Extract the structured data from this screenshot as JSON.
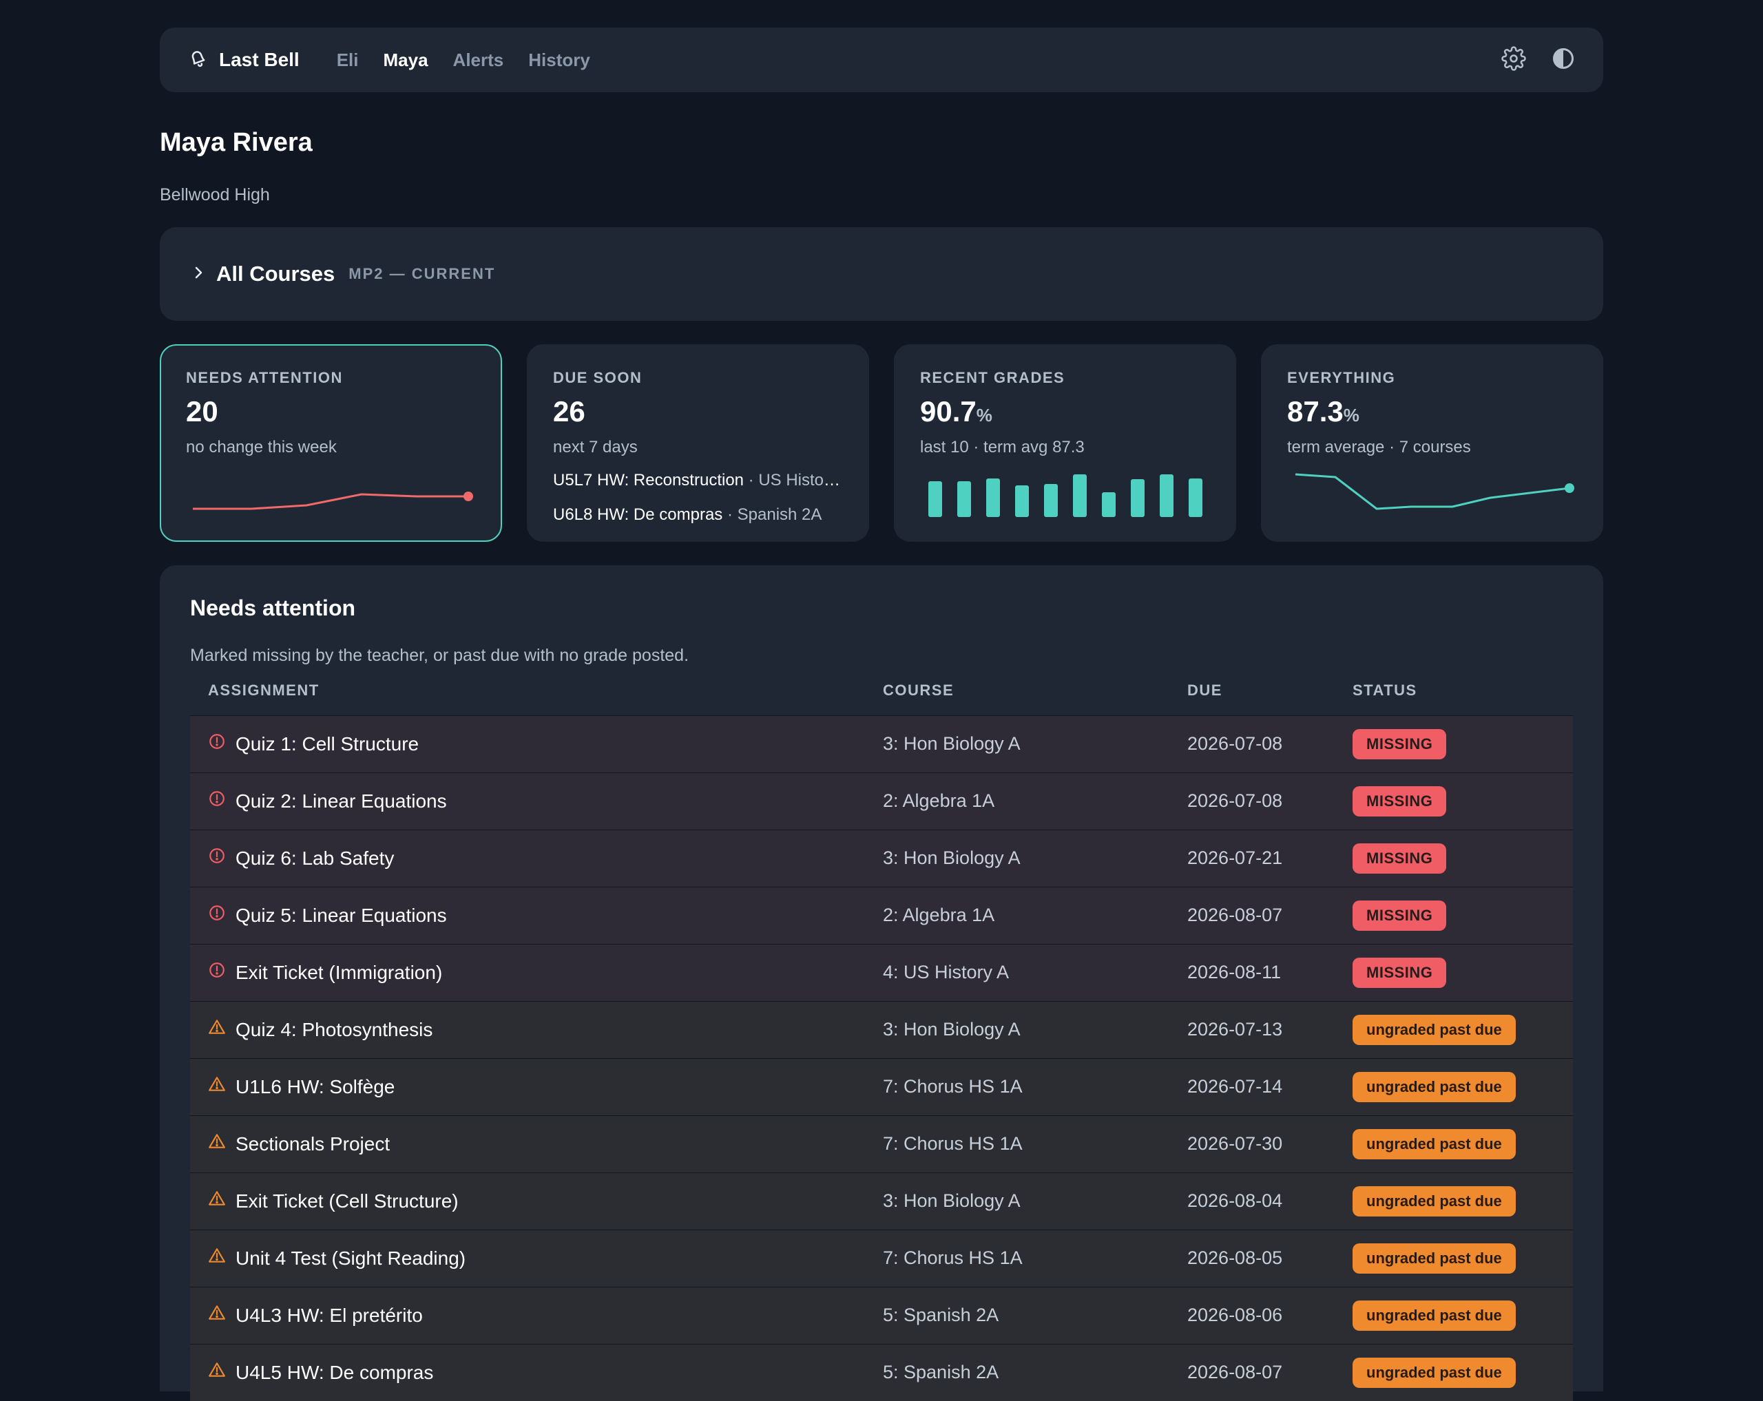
{
  "nav": {
    "brand": "Last Bell",
    "links": [
      {
        "label": "Eli",
        "active": false
      },
      {
        "label": "Maya",
        "active": true
      },
      {
        "label": "Alerts",
        "active": false
      },
      {
        "label": "History",
        "active": false
      }
    ],
    "icons": [
      "bell-icon",
      "gear-icon",
      "contrast-icon"
    ]
  },
  "student": {
    "name": "Maya Rivera",
    "school": "Bellwood High"
  },
  "courses": {
    "title": "All Courses",
    "period": "MP2 — CURRENT"
  },
  "cards": {
    "needs_attention": {
      "label": "NEEDS ATTENTION",
      "value": "20",
      "sub": "no change this week"
    },
    "due_soon": {
      "label": "DUE SOON",
      "value": "26",
      "sub": "next 7 days",
      "items": [
        {
          "title": "U5L7 HW: Reconstruction",
          "course": " · US History A"
        },
        {
          "title": "U6L8 HW: De compras",
          "course": " · Spanish 2A"
        }
      ]
    },
    "recent_grades": {
      "label": "RECENT GRADES",
      "value": "90.7",
      "unit": "%",
      "sub": "last 10 · term avg 87.3"
    },
    "everything": {
      "label": "EVERYTHING",
      "value": "87.3",
      "unit": "%",
      "sub": "term average · 7 courses"
    }
  },
  "attention": {
    "title": "Needs attention",
    "description": "Marked missing by the teacher, or past due with no grade posted.",
    "columns": [
      "ASSIGNMENT",
      "COURSE",
      "DUE",
      "STATUS"
    ],
    "rows": [
      {
        "assignment": "Quiz 1: Cell Structure",
        "course": "3: Hon Biology A",
        "due": "2026-07-08",
        "status": "MISSING",
        "kind": "missing"
      },
      {
        "assignment": "Quiz 2: Linear Equations",
        "course": "2: Algebra 1A",
        "due": "2026-07-08",
        "status": "MISSING",
        "kind": "missing"
      },
      {
        "assignment": "Quiz 6: Lab Safety",
        "course": "3: Hon Biology A",
        "due": "2026-07-21",
        "status": "MISSING",
        "kind": "missing"
      },
      {
        "assignment": "Quiz 5: Linear Equations",
        "course": "2: Algebra 1A",
        "due": "2026-08-07",
        "status": "MISSING",
        "kind": "missing"
      },
      {
        "assignment": "Exit Ticket (Immigration)",
        "course": "4: US History A",
        "due": "2026-08-11",
        "status": "MISSING",
        "kind": "missing"
      },
      {
        "assignment": "Quiz 4: Photosynthesis",
        "course": "3: Hon Biology A",
        "due": "2026-07-13",
        "status": "ungraded past due",
        "kind": "ungraded"
      },
      {
        "assignment": "U1L6 HW: Solfège",
        "course": "7: Chorus HS 1A",
        "due": "2026-07-14",
        "status": "ungraded past due",
        "kind": "ungraded"
      },
      {
        "assignment": "Sectionals Project",
        "course": "7: Chorus HS 1A",
        "due": "2026-07-30",
        "status": "ungraded past due",
        "kind": "ungraded"
      },
      {
        "assignment": "Exit Ticket (Cell Structure)",
        "course": "3: Hon Biology A",
        "due": "2026-08-04",
        "status": "ungraded past due",
        "kind": "ungraded"
      },
      {
        "assignment": "Unit 4 Test (Sight Reading)",
        "course": "7: Chorus HS 1A",
        "due": "2026-08-05",
        "status": "ungraded past due",
        "kind": "ungraded"
      },
      {
        "assignment": "U4L3 HW: El pretérito",
        "course": "5: Spanish 2A",
        "due": "2026-08-06",
        "status": "ungraded past due",
        "kind": "ungraded"
      },
      {
        "assignment": "U4L5 HW: De compras",
        "course": "5: Spanish 2A",
        "due": "2026-08-07",
        "status": "ungraded past due",
        "kind": "ungraded"
      }
    ]
  },
  "colors": {
    "accent": "#4fd1c1",
    "missing": "#f05d65",
    "ungraded": "#f08a2e",
    "trend_down": "#f06a6a"
  }
}
